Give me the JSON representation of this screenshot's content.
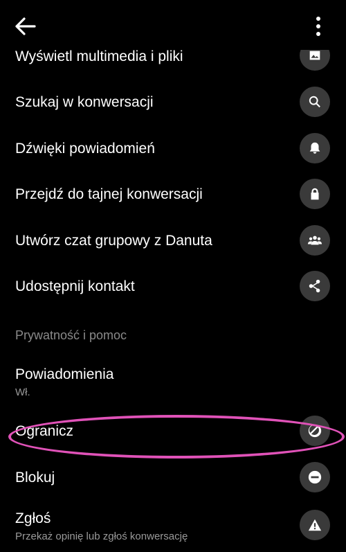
{
  "header": {
    "back_icon": "arrow-left-icon",
    "more_icon": "more-vertical-icon"
  },
  "items": [
    {
      "label": "Wyświetl multimedia i pliki",
      "icon": "image-icon"
    },
    {
      "label": "Szukaj w konwersacji",
      "icon": "search-icon"
    },
    {
      "label": "Dźwięki powiadomień",
      "icon": "bell-icon"
    },
    {
      "label": "Przejdź do tajnej konwersacji",
      "icon": "lock-icon"
    },
    {
      "label": "Utwórz czat grupowy z Danuta",
      "icon": "group-icon"
    },
    {
      "label": "Udostępnij kontakt",
      "icon": "share-icon"
    }
  ],
  "section_title": "Prywatność i pomoc",
  "notifications": {
    "label": "Powiadomienia",
    "sub": "Wł."
  },
  "restrict": {
    "label": "Ogranicz",
    "icon": "restrict-icon"
  },
  "block": {
    "label": "Blokuj",
    "icon": "block-icon"
  },
  "report": {
    "label": "Zgłoś",
    "sub": "Przekaż opinię lub zgłoś konwersację",
    "icon": "warning-icon"
  },
  "colors": {
    "background": "#000000",
    "icon_circle": "#3a3a3a",
    "annotation": "#e052b8",
    "secondary_text": "#9a9a9a"
  }
}
